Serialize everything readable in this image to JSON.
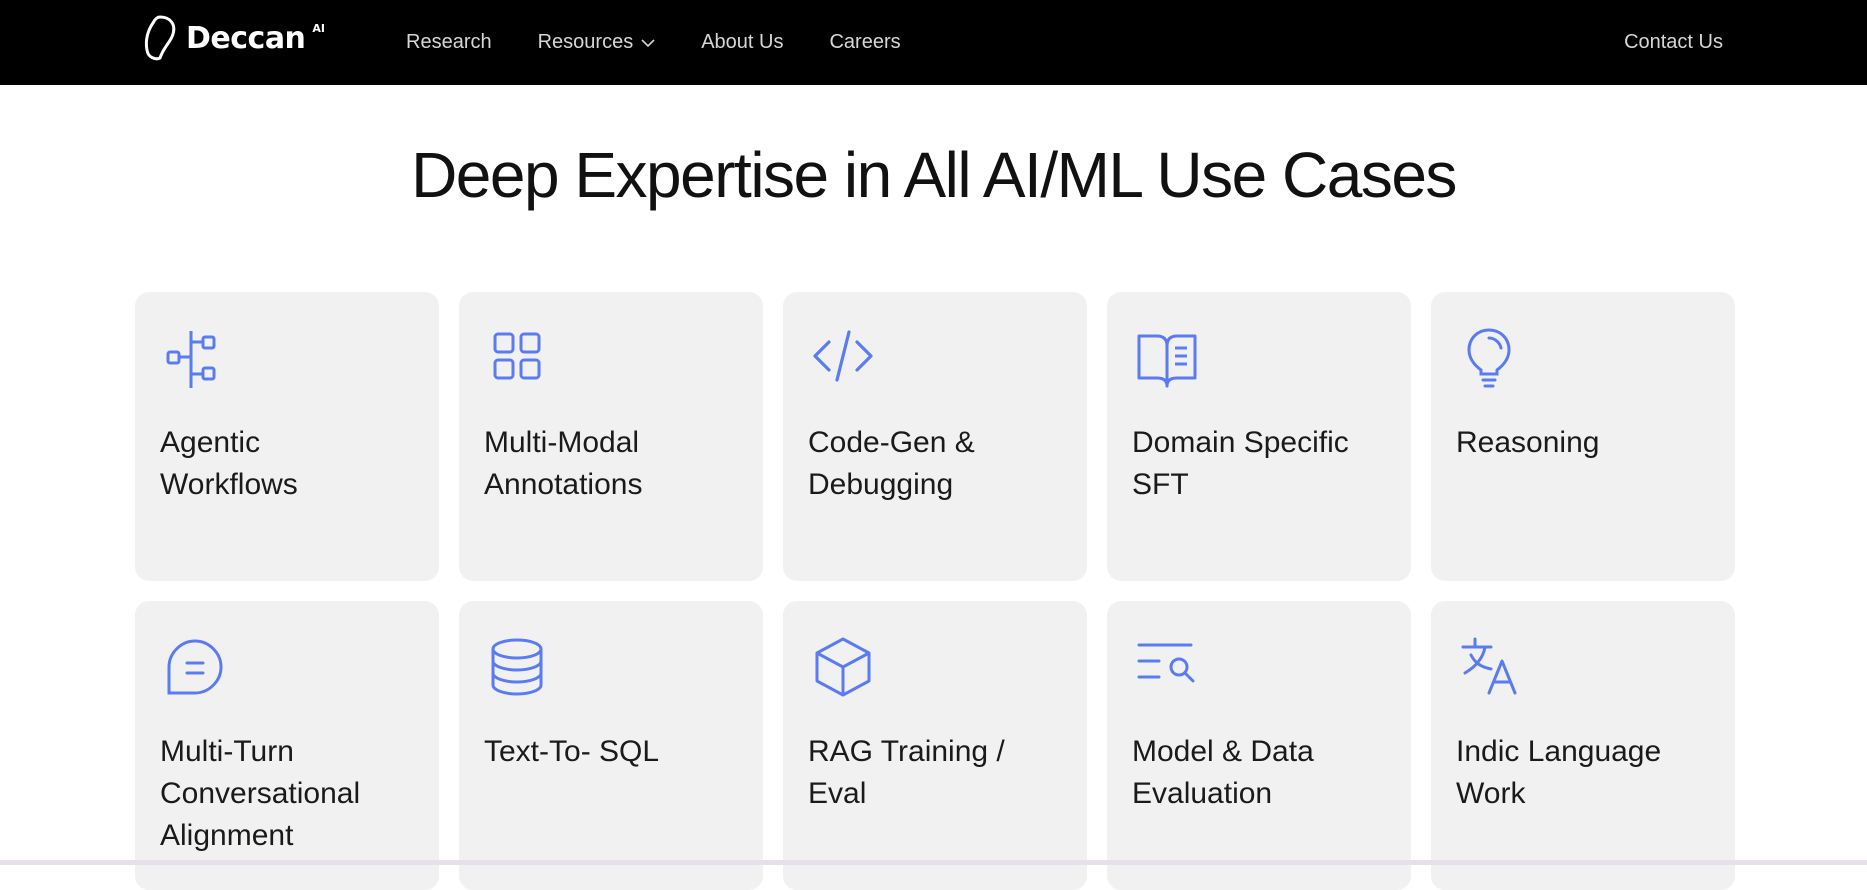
{
  "nav": {
    "brand": "Deccan",
    "brand_sup": "AI",
    "links": [
      "Research",
      "Resources",
      "About Us",
      "Careers"
    ],
    "contact": "Contact Us"
  },
  "hero": {
    "title": "Deep Expertise in All AI/ML Use Cases"
  },
  "colors": {
    "accent": "#5b7cf0",
    "card_bg": "#f1f1f2",
    "nav_bg": "#000000"
  },
  "cards": [
    {
      "label": "Agentic Workflows",
      "icon": "workflow-icon"
    },
    {
      "label": "Multi-Modal Annotations",
      "icon": "grid-icon"
    },
    {
      "label": "Code-Gen & Debugging",
      "icon": "code-icon"
    },
    {
      "label": "Domain Specific SFT",
      "icon": "book-icon"
    },
    {
      "label": "Reasoning",
      "icon": "lightbulb-icon"
    },
    {
      "label": "Multi-Turn Conversational Alignment",
      "icon": "chat-icon"
    },
    {
      "label": "Text-To- SQL",
      "icon": "database-icon"
    },
    {
      "label": "RAG Training / Eval",
      "icon": "cube-icon"
    },
    {
      "label": "Model & Data Evaluation",
      "icon": "search-list-icon"
    },
    {
      "label": "Indic Language Work",
      "icon": "translate-icon"
    }
  ]
}
